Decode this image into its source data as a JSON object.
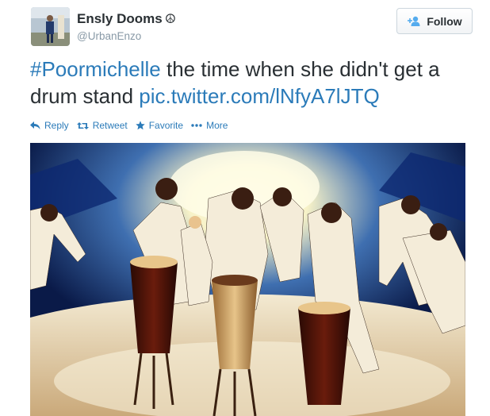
{
  "user": {
    "display_name": "Ensly Dooms",
    "name_symbol": "☮",
    "handle": "@UrbanEnzo"
  },
  "follow": {
    "label": "Follow"
  },
  "tweet": {
    "hashtag": "#Poormichelle",
    "text": " the time when she didn't get a drum stand ",
    "link": "pic.twitter.com/lNfyA7lJTQ"
  },
  "actions": {
    "reply": "Reply",
    "retweet": "Retweet",
    "favorite": "Favorite",
    "more": "More"
  },
  "colors": {
    "link": "#2b7bb9",
    "text": "#292f33",
    "muted": "#8899a6"
  }
}
